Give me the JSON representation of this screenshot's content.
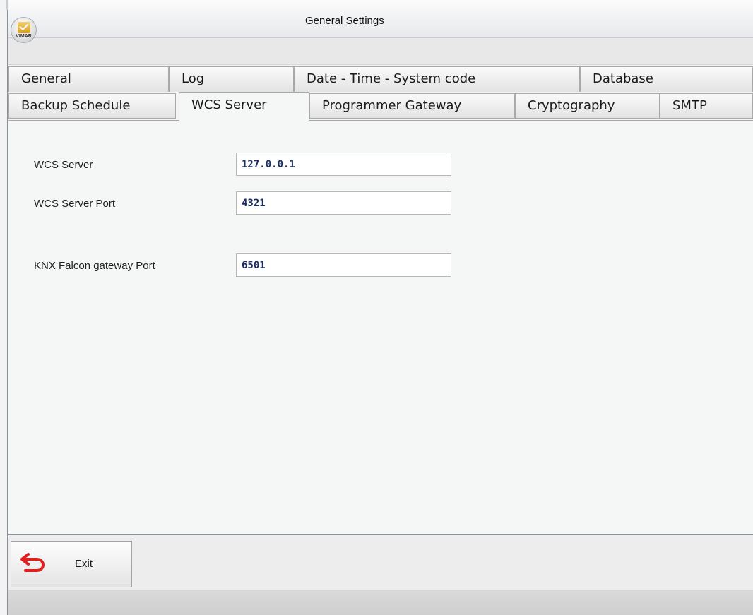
{
  "window": {
    "title": "General Settings",
    "logo_text": "VIMAR"
  },
  "tabs": {
    "row1": [
      {
        "label": "General"
      },
      {
        "label": "Log"
      },
      {
        "label": "Date - Time - System code"
      },
      {
        "label": "Database"
      }
    ],
    "row2": [
      {
        "label": "Backup Schedule"
      },
      {
        "label": "WCS Server",
        "active": true
      },
      {
        "label": "Programmer Gateway"
      },
      {
        "label": "Cryptography"
      },
      {
        "label": "SMTP"
      }
    ]
  },
  "form": {
    "wcs_server": {
      "label": "WCS Server",
      "value": "127.0.0.1"
    },
    "wcs_server_port": {
      "label": "WCS Server Port",
      "value": "4321"
    },
    "knx_falcon_gateway_port": {
      "label": "KNX Falcon gateway Port",
      "value": "6501"
    }
  },
  "footer": {
    "exit_label": "Exit",
    "exit_icon": "undo-arrow-icon",
    "exit_icon_color": "#e02020"
  }
}
